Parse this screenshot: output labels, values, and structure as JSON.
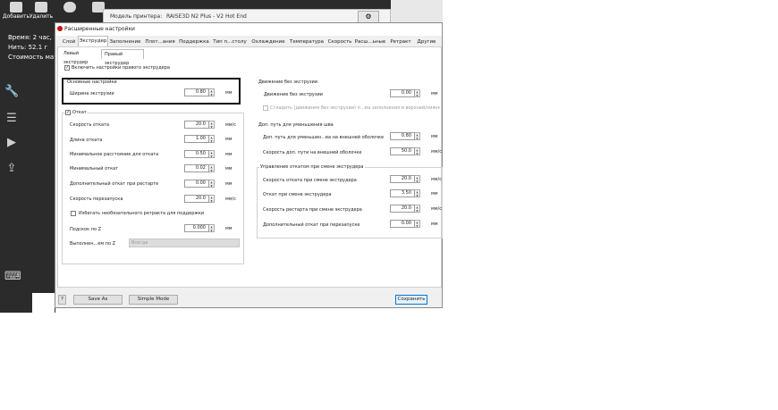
{
  "app": {
    "toolbar": [
      {
        "name": "add",
        "label": "Добавить"
      },
      {
        "name": "delete",
        "label": "Удалить"
      },
      {
        "name": "view",
        "label": ""
      },
      {
        "name": "hand",
        "label": ""
      }
    ],
    "printer_label": "Модель принтера:",
    "printer_value": "RAISE3D N2 Plus - V2 Hot End",
    "info": {
      "time": "Время: 2 час, 1",
      "filament": "Нить: 52.1 г",
      "cost": "Стоимость мате"
    }
  },
  "dialog": {
    "title": "Расширенные настройки",
    "tabs": [
      "Слой",
      "Экструдер",
      "Заполнение",
      "Плот...ания",
      "Поддержка",
      "Тип п...столу",
      "Охлаждение",
      "Температура",
      "Скорость",
      "Расш...ьные",
      "Ретракт",
      "Другие"
    ],
    "active_tab": "Экструдер",
    "subtabs": [
      "Левый экструдер",
      "Правый экструдер"
    ],
    "active_subtab": "Правый экструдер",
    "enable_label": "Включить настройки правого экструдера",
    "basic": {
      "title": "Основные настройки",
      "width_label": "Ширина экструзии",
      "width_value": "0.80",
      "width_unit": "мм"
    },
    "retract": {
      "label": "Откат",
      "rows": [
        {
          "label": "Скорость отката",
          "value": "20.0",
          "unit": "мм/с"
        },
        {
          "label": "Длина отката",
          "value": "1.00",
          "unit": "мм"
        },
        {
          "label": "Минимальное расстояние для отката",
          "value": "0.50",
          "unit": "мм"
        },
        {
          "label": "Минимальный откат",
          "value": "0.02",
          "unit": "мм"
        },
        {
          "label": "Дополнительный откат при рестарте",
          "value": "0.00",
          "unit": "мм"
        },
        {
          "label": "Скорость перезапуска",
          "value": "20.0",
          "unit": "мм/с"
        }
      ],
      "avoid_label": "Избегать необязательного ретракта для поддержки",
      "zhop_label": "Подскок по Z",
      "zhop_value": "0.000",
      "zhop_unit": "мм",
      "zhop_mode_label": "Выполнен...ем по Z",
      "zhop_mode_value": "Всегда"
    },
    "travel": {
      "title": "Движение без экструзии",
      "row_label": "Движение без экструзии",
      "row_value": "0.00",
      "row_unit": "мм",
      "smooth_label": "Сгладить (движения без экструзии) п...ма заполнения и верхней/нижней слои"
    },
    "coast": {
      "title": "Доп. путь для уменьшения шва",
      "rows": [
        {
          "label": "Доп. путь для уменьшен...ва на внешней оболочке",
          "value": "0.80",
          "unit": "мм"
        },
        {
          "label": "Скорость доп. пути на внешней оболочке",
          "value": "50.0",
          "unit": "мм/с"
        }
      ]
    },
    "toolchange": {
      "title": "Управление откатом при смене экструдера",
      "rows": [
        {
          "label": "Скорость отката при смене экструдера",
          "value": "20.0",
          "unit": "мм/с"
        },
        {
          "label": "Откат при смене экструдера",
          "value": "3.50",
          "unit": "мм"
        },
        {
          "label": "Скорость рестарта при смене экструдера",
          "value": "20.0",
          "unit": "мм/с"
        },
        {
          "label": "Дополнительный откат при перезапуске",
          "value": "0.00",
          "unit": "мм"
        }
      ]
    },
    "footer": {
      "help": "?",
      "save_as": "Save As",
      "simple_mode": "Simple Mode",
      "save": "Сохранить"
    }
  }
}
